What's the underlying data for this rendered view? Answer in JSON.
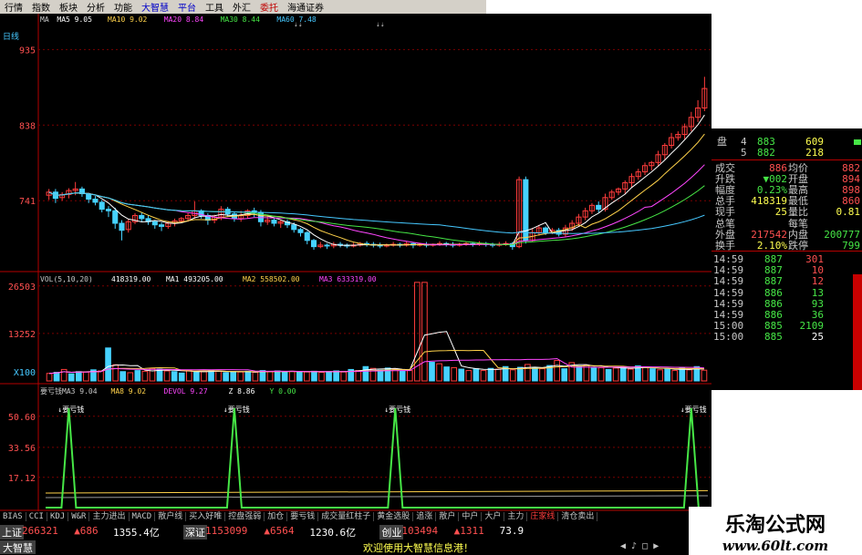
{
  "menu": {
    "items": [
      {
        "label": "行情",
        "style": "normal"
      },
      {
        "label": "指数",
        "style": "normal"
      },
      {
        "label": "板块",
        "style": "normal"
      },
      {
        "label": "分析",
        "style": "normal"
      },
      {
        "label": "功能",
        "style": "normal"
      },
      {
        "label": "大智慧",
        "style": "blue"
      },
      {
        "label": "平台",
        "style": "blue"
      },
      {
        "label": "工具",
        "style": "normal"
      },
      {
        "label": "外汇",
        "style": "normal"
      },
      {
        "label": "委托",
        "style": "red"
      },
      {
        "label": "海通证券",
        "style": "normal"
      }
    ]
  },
  "price_panel": {
    "period_label": "日线",
    "ma_legend": [
      {
        "text": "MA",
        "color": "#c8c8c8"
      },
      {
        "text": "MA5 9.05",
        "color": "#ffffff"
      },
      {
        "text": "MA10 9.02",
        "color": "#ffd24a"
      },
      {
        "text": "MA20 8.84",
        "color": "#ff46ff"
      },
      {
        "text": "MA30 8.44",
        "color": "#46e646"
      },
      {
        "text": "MA60 7.48",
        "color": "#46c8ff"
      }
    ],
    "axis_labels": [
      "935",
      "838",
      "741"
    ]
  },
  "volume_panel": {
    "legend": [
      {
        "text": "VOL(5,10,20)",
        "color": "#c8c8c8"
      },
      {
        "text": "418319.00",
        "color": "#ffffff"
      },
      {
        "text": "MA1 493205.00",
        "color": "#ffffff"
      },
      {
        "text": "MA2 558502.00",
        "color": "#ffd24a"
      },
      {
        "text": "MA3 633319.00",
        "color": "#ff46ff"
      }
    ],
    "axis_labels": [
      "26503",
      "13252",
      "X100"
    ]
  },
  "indicator_panel": {
    "legend": [
      {
        "text": "要亏钱MA3 9.04",
        "color": "#c8c8c8"
      },
      {
        "text": "MA8 9.02",
        "color": "#ffd24a"
      },
      {
        "text": "DEVOL 9.27",
        "color": "#ff46ff"
      },
      {
        "text": "Z 8.86",
        "color": "#ffffff"
      },
      {
        "text": "Y 0.00",
        "color": "#46e646"
      }
    ],
    "axis_labels": [
      "50.60",
      "33.56",
      "17.12"
    ],
    "signal_label": "↓要亏钱"
  },
  "quote_panel": {
    "top_rows": [
      {
        "label": "盘",
        "n": "4",
        "v1": "883",
        "v2": "609"
      },
      {
        "label": "",
        "n": "5",
        "v1": "882",
        "v2": "218"
      }
    ],
    "stats": [
      {
        "label": "成交",
        "v1": "886",
        "label2": "均价",
        "v2": "882",
        "c1": "#ff5050",
        "c2": "#ff5050"
      },
      {
        "label": "升跌",
        "v1": "▼002",
        "label2": "开盘",
        "v2": "894",
        "c1": "#46e646",
        "c2": "#ff5050"
      },
      {
        "label": "幅度",
        "v1": "0.23%",
        "label2": "最高",
        "v2": "898",
        "c1": "#46e646",
        "c2": "#ff5050"
      },
      {
        "label": "总手",
        "v1": "418319",
        "label2": "最低",
        "v2": "860",
        "c1": "#ffff50",
        "c2": "#ff5050"
      },
      {
        "label": "现手",
        "v1": "25",
        "label2": "量比",
        "v2": "0.81",
        "c1": "#ffff50",
        "c2": "#ffff50"
      },
      {
        "label": "总笔",
        "v1": "",
        "label2": "每笔",
        "v2": "",
        "c1": "#ffff50",
        "c2": "#ffff50"
      },
      {
        "label": "外盘",
        "v1": "217542",
        "label2": "内盘",
        "v2": "200777",
        "c1": "#ff5050",
        "c2": "#46e646"
      },
      {
        "label": "换手",
        "v1": "2.10%",
        "label2": "跌停",
        "v2": "799",
        "c1": "#ffff50",
        "c2": "#46e646"
      }
    ],
    "ticks": [
      {
        "time": "14:59",
        "price": "887",
        "vol": "301",
        "vc": "#ff5050"
      },
      {
        "time": "14:59",
        "price": "887",
        "vol": "10",
        "vc": "#ff5050"
      },
      {
        "time": "14:59",
        "price": "887",
        "vol": "12",
        "vc": "#ff5050"
      },
      {
        "time": "14:59",
        "price": "886",
        "vol": "13",
        "vc": "#46e646"
      },
      {
        "time": "14:59",
        "price": "886",
        "vol": "93",
        "vc": "#46e646"
      },
      {
        "time": "14:59",
        "price": "886",
        "vol": "36",
        "vc": "#46e646"
      },
      {
        "time": "15:00",
        "price": "885",
        "vol": "2109",
        "vc": "#46e646"
      },
      {
        "time": "15:00",
        "price": "885",
        "vol": "25",
        "vc": "#ffffff"
      }
    ]
  },
  "indicator_tabs": [
    "BIAS",
    "CCI",
    "KDJ",
    "W&R",
    "主力进出",
    "MACD",
    "散户线",
    "买入好唯",
    "控盘强弱",
    "加仓",
    "要亏钱",
    "成交量红柱子",
    "黄金选股",
    "追涨",
    "散户",
    "中户",
    "大户",
    "主力",
    "庄家线",
    "清仓卖出"
  ],
  "active_tab_index": 18,
  "status": {
    "row1": [
      {
        "text": "上证",
        "color": "#ffffff",
        "bg": "#404040"
      },
      {
        "text": "266321",
        "color": "#ff5050"
      },
      {
        "text": "▲686",
        "color": "#ff5050"
      },
      {
        "text": "1355.4亿",
        "color": "#ffffff"
      },
      {
        "text": "深证",
        "color": "#ffffff",
        "bg": "#404040"
      },
      {
        "text": "1153099",
        "color": "#ff5050"
      },
      {
        "text": "▲6564",
        "color": "#ff5050"
      },
      {
        "text": "1230.6亿",
        "color": "#ffffff"
      },
      {
        "text": "创业",
        "color": "#ffffff",
        "bg": "#404040"
      },
      {
        "text": "103494",
        "color": "#ff5050"
      },
      {
        "text": "▲1311",
        "color": "#ff5050"
      },
      {
        "text": "73.9",
        "color": "#ffffff"
      }
    ],
    "app_label": "大智慧",
    "message": "欢迎使用大智慧信息港！"
  },
  "watermark": {
    "title": "乐淘公式网",
    "url": "www.60lt.com"
  },
  "colors": {
    "up": "#ff3c3c",
    "down": "#46d2ff",
    "grid": "#7a0000",
    "axis": "#b40000"
  },
  "chart_data": [
    {
      "type": "candlestick",
      "title": "日线",
      "y_axis_ticks": [
        935,
        838,
        741
      ],
      "ylim": [
        650,
        960
      ],
      "candles": [
        [
          748,
          752,
          742,
          756
        ],
        [
          752,
          744,
          738,
          756
        ],
        [
          745,
          749,
          741,
          752
        ],
        [
          749,
          754,
          744,
          757
        ],
        [
          754,
          756,
          748,
          765
        ],
        [
          756,
          750,
          746,
          759
        ],
        [
          749,
          743,
          738,
          751
        ],
        [
          743,
          739,
          735,
          747
        ],
        [
          739,
          730,
          726,
          742
        ],
        [
          730,
          728,
          720,
          734
        ],
        [
          728,
          712,
          705,
          732
        ],
        [
          712,
          703,
          690,
          716
        ],
        [
          704,
          714,
          700,
          717
        ],
        [
          714,
          722,
          711,
          725
        ],
        [
          722,
          718,
          714,
          726
        ],
        [
          718,
          714,
          710,
          722
        ],
        [
          714,
          710,
          705,
          716
        ],
        [
          710,
          708,
          702,
          713
        ],
        [
          708,
          712,
          705,
          715
        ],
        [
          712,
          715,
          708,
          718
        ],
        [
          715,
          718,
          712,
          720
        ],
        [
          718,
          722,
          714,
          725
        ],
        [
          722,
          728,
          718,
          740
        ],
        [
          728,
          722,
          718,
          730
        ],
        [
          722,
          716,
          710,
          725
        ],
        [
          716,
          720,
          712,
          723
        ],
        [
          720,
          730,
          716,
          734
        ],
        [
          730,
          724,
          720,
          733
        ],
        [
          724,
          718,
          714,
          727
        ],
        [
          718,
          722,
          714,
          728
        ],
        [
          722,
          728,
          718,
          730
        ],
        [
          728,
          726,
          720,
          732
        ],
        [
          726,
          714,
          708,
          729
        ],
        [
          714,
          716,
          710,
          722
        ],
        [
          716,
          712,
          708,
          719
        ],
        [
          712,
          714,
          706,
          716
        ],
        [
          714,
          710,
          706,
          717
        ],
        [
          710,
          704,
          700,
          713
        ],
        [
          704,
          700,
          695,
          706
        ],
        [
          700,
          690,
          685,
          702
        ],
        [
          690,
          682,
          678,
          692
        ],
        [
          682,
          684,
          680,
          688
        ],
        [
          684,
          683,
          679,
          686
        ],
        [
          683,
          685,
          680,
          688
        ],
        [
          685,
          684,
          681,
          688
        ],
        [
          684,
          683,
          680,
          686
        ],
        [
          683,
          684,
          681,
          687
        ],
        [
          684,
          686,
          682,
          688
        ],
        [
          686,
          685,
          682,
          689
        ],
        [
          685,
          684,
          681,
          688
        ],
        [
          684,
          683,
          680,
          687
        ],
        [
          683,
          684,
          681,
          686
        ],
        [
          684,
          685,
          682,
          688
        ],
        [
          685,
          684,
          681,
          687
        ],
        [
          684,
          686,
          682,
          689
        ],
        [
          686,
          684,
          680,
          688
        ],
        [
          684,
          685,
          682,
          687
        ],
        [
          685,
          684,
          681,
          688
        ],
        [
          684,
          685,
          682,
          686
        ],
        [
          685,
          686,
          683,
          689
        ],
        [
          686,
          685,
          682,
          688
        ],
        [
          685,
          684,
          681,
          688
        ],
        [
          684,
          685,
          682,
          687
        ],
        [
          685,
          686,
          683,
          688
        ],
        [
          686,
          685,
          682,
          688
        ],
        [
          685,
          686,
          683,
          689
        ],
        [
          686,
          685,
          682,
          688
        ],
        [
          685,
          684,
          681,
          687
        ],
        [
          684,
          685,
          682,
          688
        ],
        [
          685,
          686,
          683,
          689
        ],
        [
          686,
          682,
          678,
          688
        ],
        [
          682,
          768,
          680,
          772
        ],
        [
          768,
          690,
          686,
          772
        ],
        [
          690,
          700,
          688,
          706
        ],
        [
          700,
          706,
          696,
          710
        ],
        [
          706,
          700,
          697,
          708
        ],
        [
          700,
          703,
          698,
          706
        ],
        [
          703,
          698,
          695,
          706
        ],
        [
          698,
          706,
          694,
          710
        ],
        [
          706,
          712,
          702,
          716
        ],
        [
          712,
          720,
          708,
          724
        ],
        [
          720,
          728,
          716,
          732
        ],
        [
          728,
          735,
          724,
          738
        ],
        [
          735,
          730,
          726,
          740
        ],
        [
          730,
          745,
          727,
          750
        ],
        [
          745,
          752,
          742,
          755
        ],
        [
          752,
          756,
          748,
          758
        ],
        [
          756,
          764,
          750,
          767
        ],
        [
          764,
          772,
          758,
          776
        ],
        [
          772,
          778,
          768,
          782
        ],
        [
          778,
          786,
          774,
          790
        ],
        [
          786,
          790,
          780,
          792
        ],
        [
          790,
          800,
          786,
          805
        ],
        [
          800,
          812,
          794,
          815
        ],
        [
          812,
          822,
          808,
          828
        ],
        [
          822,
          826,
          818,
          830
        ],
        [
          826,
          836,
          820,
          840
        ],
        [
          836,
          848,
          830,
          855
        ],
        [
          848,
          860,
          842,
          870
        ],
        [
          860,
          885,
          856,
          900
        ]
      ],
      "moving_averages": [
        {
          "name": "MA5",
          "value": 9.05,
          "color": "#ffffff"
        },
        {
          "name": "MA10",
          "value": 9.02,
          "color": "#ffd24a"
        },
        {
          "name": "MA20",
          "value": 8.84,
          "color": "#ff46ff"
        },
        {
          "name": "MA30",
          "value": 8.44,
          "color": "#46e646"
        },
        {
          "name": "MA60",
          "value": 7.48,
          "color": "#46c8ff"
        }
      ]
    },
    {
      "type": "bar",
      "title": "VOL(5,10,20)",
      "y_axis_ticks": [
        26503,
        13252
      ],
      "unit": "X100",
      "ylim": [
        0,
        30000
      ],
      "values": [
        2100,
        2400,
        3200,
        2000,
        2600,
        2500,
        3100,
        2800,
        9200,
        4500,
        2600,
        2300,
        2900,
        2700,
        3500,
        3300,
        2800,
        2600,
        2200,
        3000,
        2500,
        2600,
        2900,
        2700,
        2300,
        2600,
        2500,
        2700,
        2400,
        2900,
        2600,
        2800,
        2500,
        2700,
        2600,
        2500,
        2700,
        2400,
        2600,
        2800,
        2500,
        3200,
        2900,
        4000,
        3500,
        3000,
        3600,
        3300,
        2800,
        2900,
        27500,
        27500,
        5200,
        4800,
        3900,
        3700,
        3300,
        2900,
        3400,
        2900,
        3500,
        3300,
        4000,
        3100,
        3800,
        4600,
        3700,
        3400,
        4300,
        5700,
        3400,
        5100,
        4200,
        4400,
        3800,
        3700,
        3200,
        3600,
        3900,
        3300,
        4200,
        3700,
        3400,
        3100,
        3300,
        2900,
        3600,
        3100,
        4000,
        3000
      ],
      "up_flags": [
        1,
        0,
        1,
        0,
        0,
        1,
        0,
        1,
        0,
        1,
        0,
        1,
        0,
        1,
        1,
        0,
        1,
        0,
        0,
        1,
        0,
        1,
        0,
        1,
        0,
        0,
        1,
        0,
        1,
        0,
        1,
        0,
        0,
        1,
        0,
        1,
        0,
        1,
        0,
        0,
        1,
        0,
        1,
        0,
        1,
        0,
        0,
        1,
        0,
        1,
        1,
        1,
        0,
        1,
        0,
        1,
        0,
        1,
        0,
        1,
        0,
        1,
        0,
        1,
        0,
        1,
        0,
        1,
        0,
        1,
        0,
        1,
        0,
        1,
        0,
        1,
        0,
        1,
        0,
        1,
        0,
        1,
        0,
        1,
        0,
        1,
        0,
        1,
        0,
        1
      ]
    },
    {
      "type": "line",
      "title": "要亏钱",
      "y_axis_ticks": [
        50.6,
        33.56,
        17.12
      ],
      "ylim": [
        0,
        60
      ],
      "spike_positions": [
        0.035,
        0.285,
        0.528,
        0.975
      ],
      "spike_height": 55,
      "baseline": 8
    }
  ]
}
